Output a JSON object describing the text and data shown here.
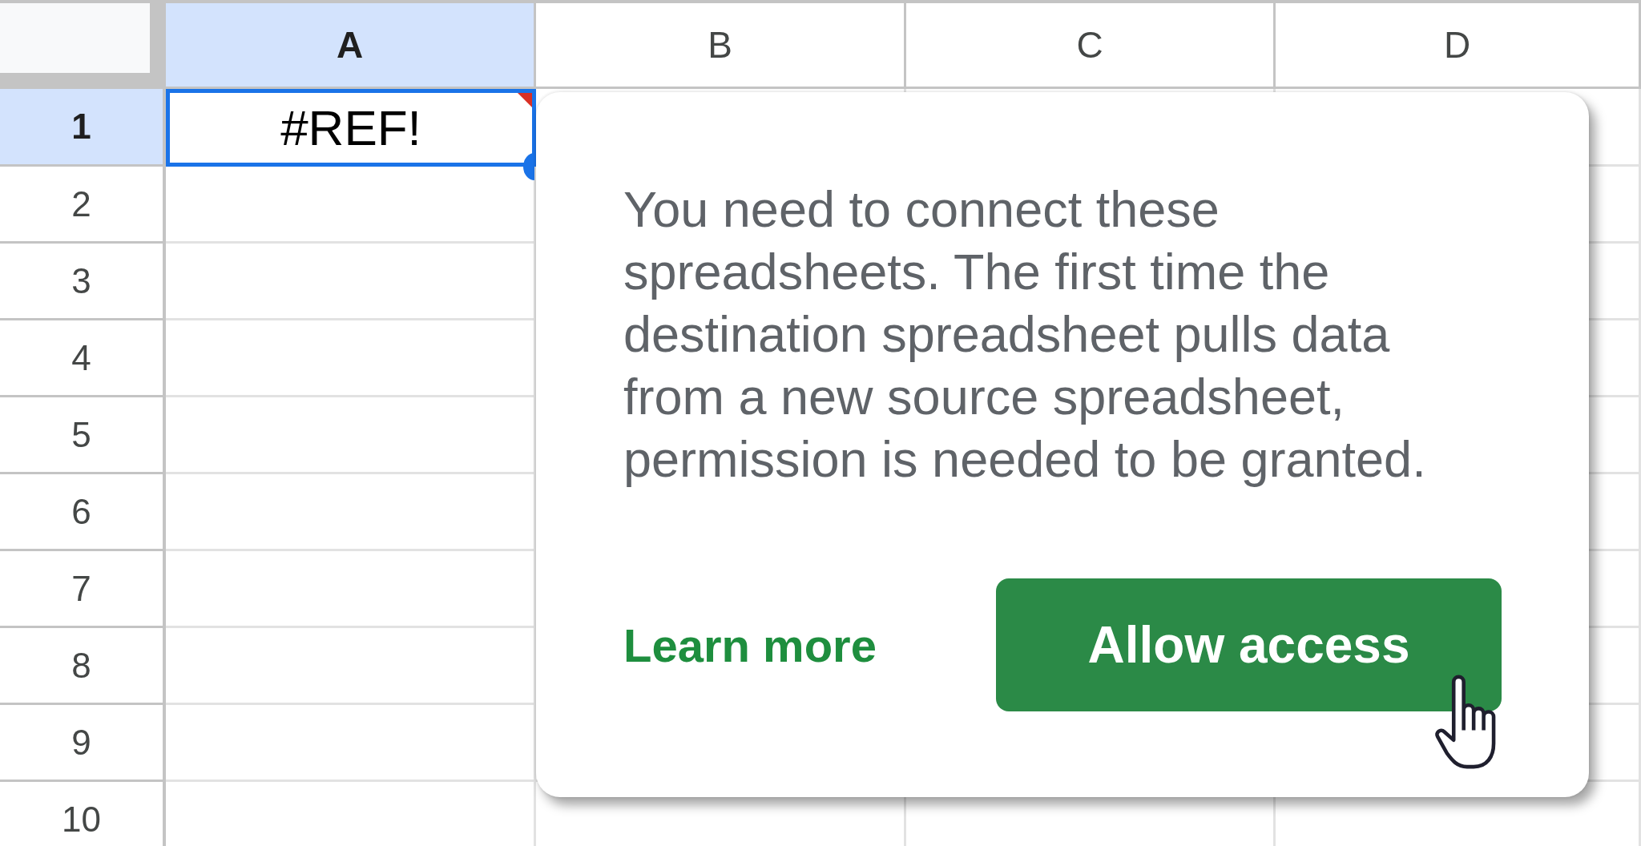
{
  "sheet": {
    "columns": [
      {
        "label": "A",
        "selected": true
      },
      {
        "label": "B",
        "selected": false
      },
      {
        "label": "C",
        "selected": false
      },
      {
        "label": "D",
        "selected": false
      }
    ],
    "rows": [
      {
        "label": "1",
        "selected": true,
        "cells": [
          {
            "value": "#REF!",
            "selected": true,
            "error": true
          }
        ]
      },
      {
        "label": "2",
        "selected": false
      },
      {
        "label": "3",
        "selected": false
      },
      {
        "label": "4",
        "selected": false
      },
      {
        "label": "5",
        "selected": false
      },
      {
        "label": "6",
        "selected": false
      },
      {
        "label": "7",
        "selected": false
      },
      {
        "label": "8",
        "selected": false
      },
      {
        "label": "9",
        "selected": false
      },
      {
        "label": "10",
        "selected": false
      }
    ]
  },
  "popup": {
    "message": "You need to connect these spreadsheets. The first time the destination spreadsheet pulls data from a new source spreadsheet, permission is needed to be granted.",
    "link": "Learn more",
    "button": "Allow access"
  }
}
